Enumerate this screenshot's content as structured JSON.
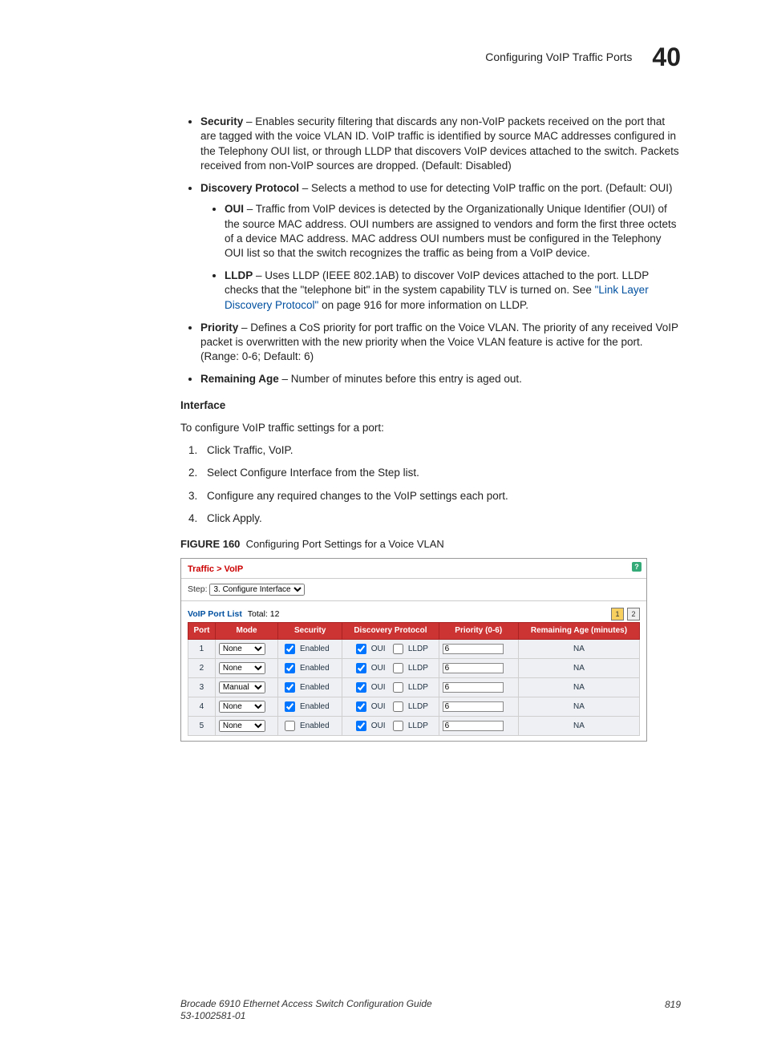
{
  "header": {
    "title": "Configuring VoIP Traffic Ports",
    "chapter": "40"
  },
  "bullets": {
    "security": {
      "term": "Security",
      "text": " – Enables security filtering that discards any non-VoIP packets received on the port that are tagged with the voice VLAN ID. VoIP traffic is identified by source MAC addresses configured in the Telephony OUI list, or through LLDP that discovers VoIP devices attached to the switch. Packets received from non-VoIP sources are dropped. (Default: Disabled)"
    },
    "discovery": {
      "term": "Discovery Protocol",
      "text": " – Selects a method to use for detecting VoIP traffic on the port. (Default: OUI)"
    },
    "oui": {
      "term": "OUI",
      "text": " – Traffic from VoIP devices is detected by the Organizationally Unique Identifier (OUI) of the source MAC address. OUI numbers are assigned to vendors and form the first three octets of a device MAC address. MAC address OUI numbers must be configured in the Telephony OUI list so that the switch recognizes the traffic as being from a VoIP device."
    },
    "lldp": {
      "term": "LLDP",
      "pre": " – Uses LLDP (IEEE 802.1AB) to discover VoIP devices attached to the port. LLDP checks that the \"telephone bit\" in the system capability TLV is turned on. See ",
      "link": "\"Link Layer Discovery Protocol\"",
      "post": " on page 916 for more information on LLDP."
    },
    "priority": {
      "term": "Priority",
      "text": " – Defines a CoS priority for port traffic on the Voice VLAN. The priority of any received VoIP packet is overwritten with the new priority when the Voice VLAN feature is active for the port. (Range: 0-6; Default: 6)"
    },
    "age": {
      "term": "Remaining Age",
      "text": " – Number of minutes before this entry is aged out."
    }
  },
  "interface": {
    "heading": "Interface",
    "intro": "To configure VoIP traffic settings for a port:",
    "steps": [
      "Click Traffic, VoIP.",
      "Select Configure Interface from the Step list.",
      "Configure any required changes to the VoIP settings each port.",
      "Click Apply."
    ]
  },
  "figure": {
    "caption_prefix": "FIGURE 160",
    "caption": "Configuring Port Settings for a Voice VLAN",
    "crumb": "Traffic > VoIP",
    "step_label": "Step:",
    "step_value": "3. Configure Interface",
    "list_label": "VoIP Port List",
    "list_total": "Total: 12",
    "help": "?",
    "pagers": [
      "1",
      "2"
    ],
    "cols": [
      "Port",
      "Mode",
      "Security",
      "Discovery Protocol",
      "Priority (0-6)",
      "Remaining Age (minutes)"
    ],
    "enabled_label": "Enabled",
    "oui_label": "OUI",
    "lldp_label": "LLDP",
    "rows": [
      {
        "port": "1",
        "mode": "None",
        "sec": true,
        "oui": true,
        "lldp": false,
        "prio": "6",
        "age": "NA"
      },
      {
        "port": "2",
        "mode": "None",
        "sec": true,
        "oui": true,
        "lldp": false,
        "prio": "6",
        "age": "NA"
      },
      {
        "port": "3",
        "mode": "Manual",
        "sec": true,
        "oui": true,
        "lldp": false,
        "prio": "6",
        "age": "NA"
      },
      {
        "port": "4",
        "mode": "None",
        "sec": true,
        "oui": true,
        "lldp": false,
        "prio": "6",
        "age": "NA"
      },
      {
        "port": "5",
        "mode": "None",
        "sec": false,
        "oui": true,
        "lldp": false,
        "prio": "6",
        "age": "NA"
      }
    ]
  },
  "footer": {
    "line1": "Brocade 6910 Ethernet Access Switch Configuration Guide",
    "line2": "53-1002581-01",
    "page": "819"
  }
}
